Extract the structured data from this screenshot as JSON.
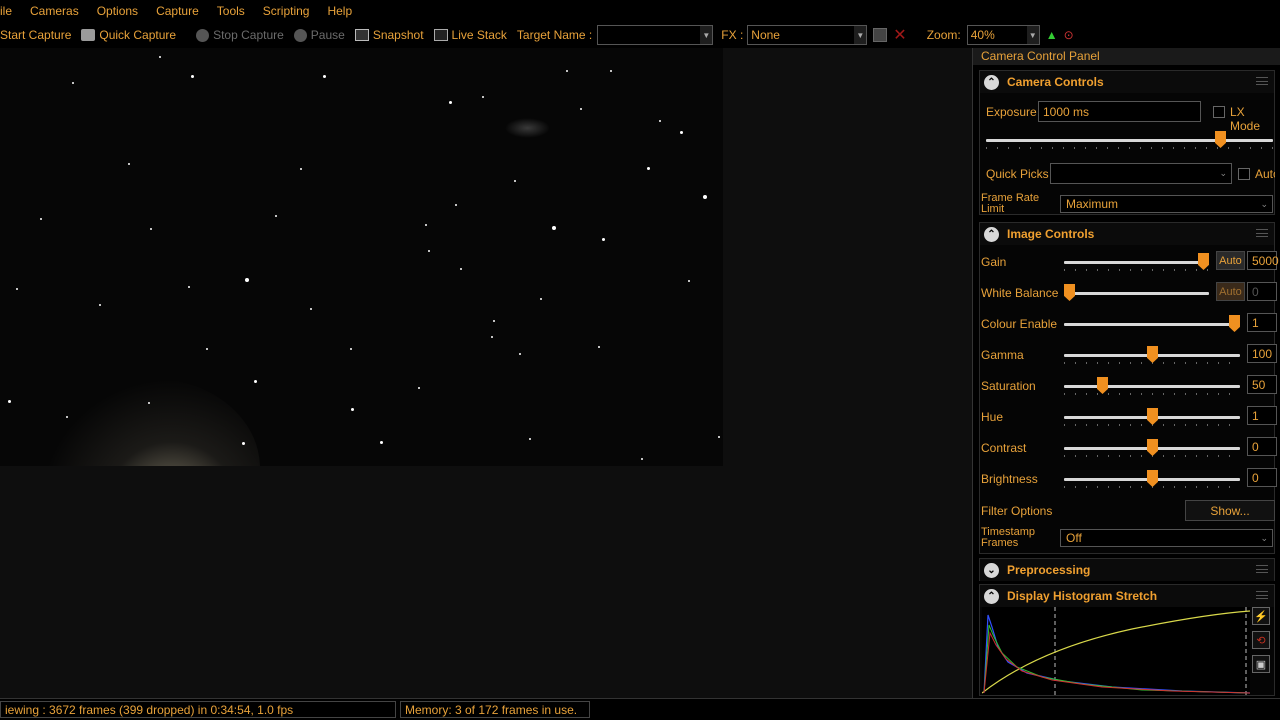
{
  "menu": [
    "ile",
    "Cameras",
    "Options",
    "Capture",
    "Tools",
    "Scripting",
    "Help"
  ],
  "toolbar": {
    "start_capture": "Start Capture",
    "quick_capture": "Quick Capture",
    "stop_capture": "Stop Capture",
    "pause": "Pause",
    "snapshot": "Snapshot",
    "live_stack": "Live Stack",
    "target_name_label": "Target Name :",
    "target_name_value": "",
    "fx_label": "FX :",
    "fx_value": "None",
    "zoom_label": "Zoom:",
    "zoom_value": "40%"
  },
  "panel": {
    "title": "Camera Control Panel",
    "camera_controls": {
      "heading": "Camera Controls",
      "exposure_label": "Exposure",
      "exposure_value": "1000 ms",
      "lx_mode_label": "LX Mode",
      "exposure_slider_fraction": 0.83,
      "quick_picks_label": "Quick Picks",
      "quick_picks_value": "",
      "auto_label": "Auto",
      "frame_rate_label": "Frame Rate Limit",
      "frame_rate_value": "Maximum"
    },
    "image_controls": {
      "heading": "Image Controls",
      "gain": {
        "label": "Gain",
        "auto": "Auto",
        "value": "5000",
        "fraction": 1.0
      },
      "white_balance": {
        "label": "White Balance",
        "auto": "Auto",
        "value": "0",
        "fraction": 0.0
      },
      "colour_enable": {
        "label": "Colour Enable",
        "value": "1",
        "fraction": 1.0
      },
      "gamma": {
        "label": "Gamma",
        "value": "100",
        "fraction": 0.5
      },
      "saturation": {
        "label": "Saturation",
        "value": "50",
        "fraction": 0.2
      },
      "hue": {
        "label": "Hue",
        "value": "1",
        "fraction": 0.5
      },
      "contrast": {
        "label": "Contrast",
        "value": "0",
        "fraction": 0.5
      },
      "brightness": {
        "label": "Brightness",
        "value": "0",
        "fraction": 0.5
      },
      "filter_options_label": "Filter Options",
      "show_button": "Show...",
      "timestamp_label": "Timestamp Frames",
      "timestamp_value": "Off"
    },
    "preprocessing": {
      "heading": "Preprocessing"
    },
    "histogram": {
      "heading": "Display Histogram Stretch"
    }
  },
  "status": {
    "viewing": "iewing : 3672 frames (399 dropped) in 0:34:54, 1.0 fps",
    "memory": "Memory: 3 of 172 frames in use."
  },
  "colors": {
    "accent": "#e8a23a",
    "thumb": "#f09020",
    "background": "#000000"
  }
}
